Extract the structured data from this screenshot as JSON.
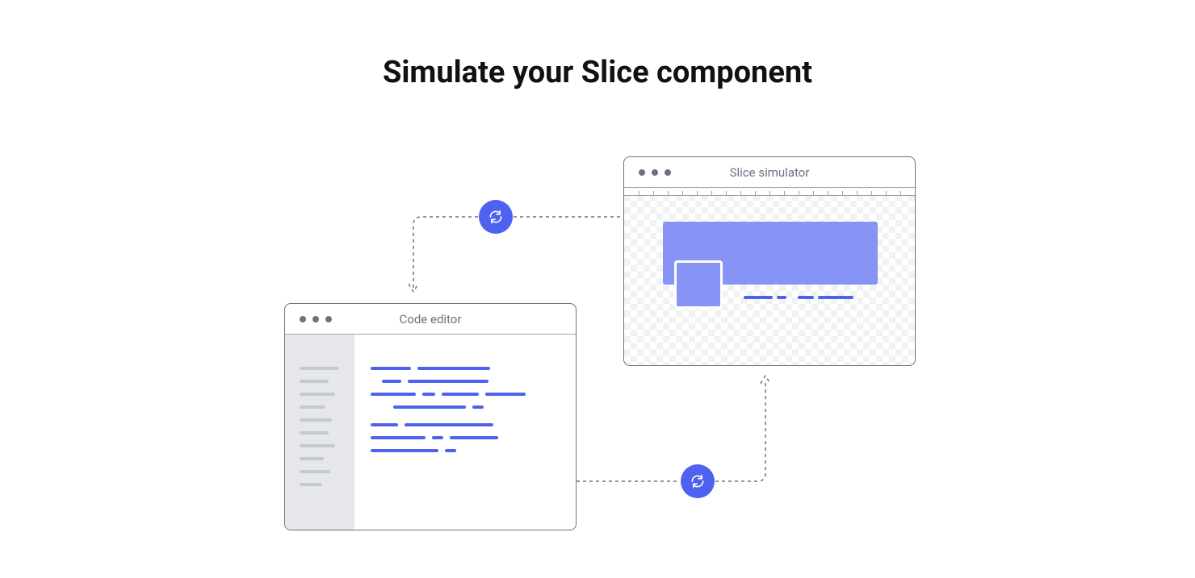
{
  "title": "Simulate your Slice component",
  "code_editor": {
    "title": "Code editor"
  },
  "slice_simulator": {
    "title": "Slice simulator"
  }
}
